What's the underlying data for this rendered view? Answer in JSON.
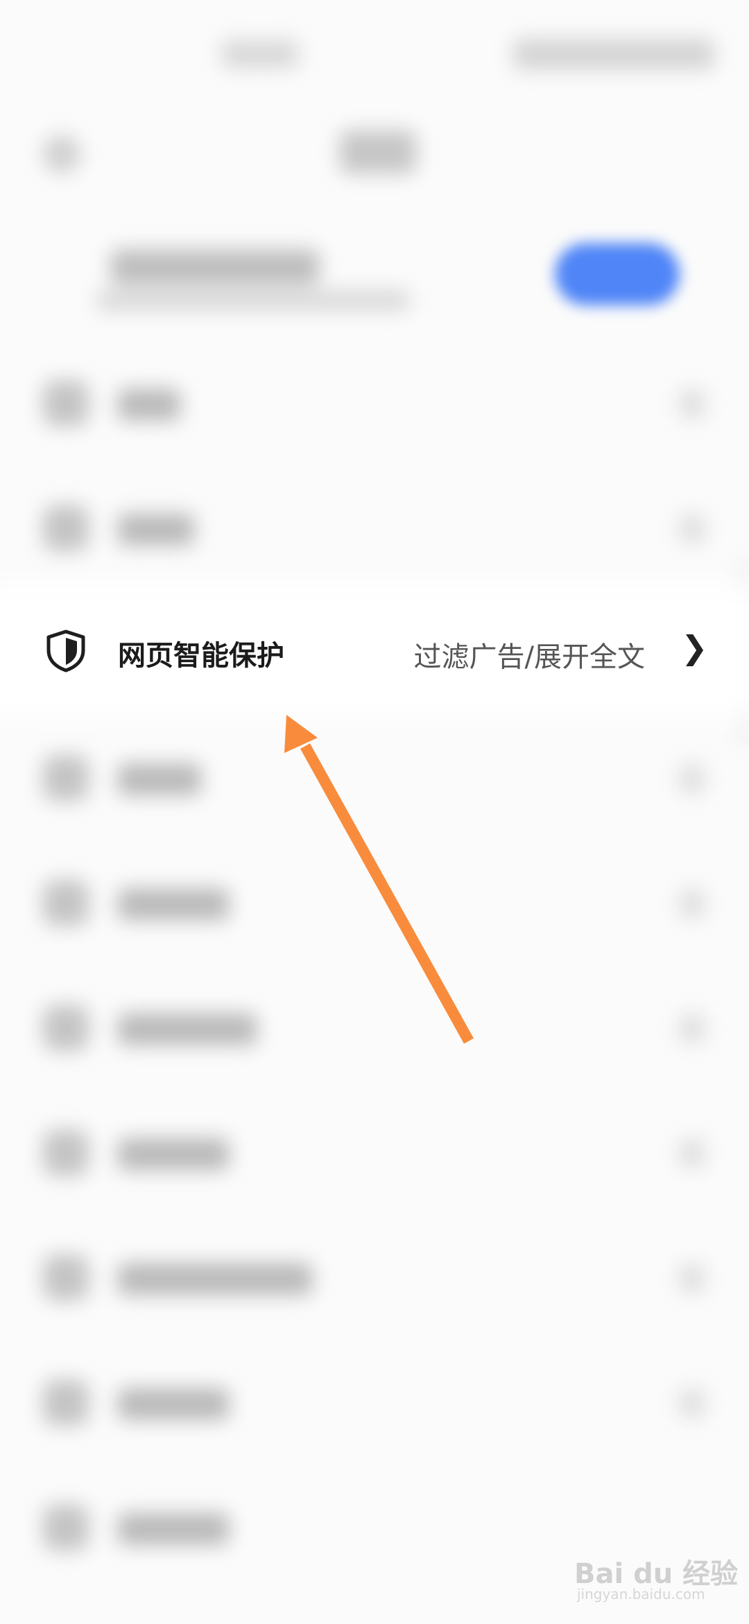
{
  "settings_row": {
    "label": "网页智能保护",
    "value": "过滤广告/展开全文",
    "chevron": "❯",
    "icon": "shield-icon"
  },
  "annotation": {
    "arrow_color": "#f98c3c"
  },
  "watermark": {
    "brand": "Bai du 经验",
    "url": "jingyan.baidu.com"
  },
  "colors": {
    "accent_button": "#4f85f7",
    "background": "#fbfbfb"
  }
}
